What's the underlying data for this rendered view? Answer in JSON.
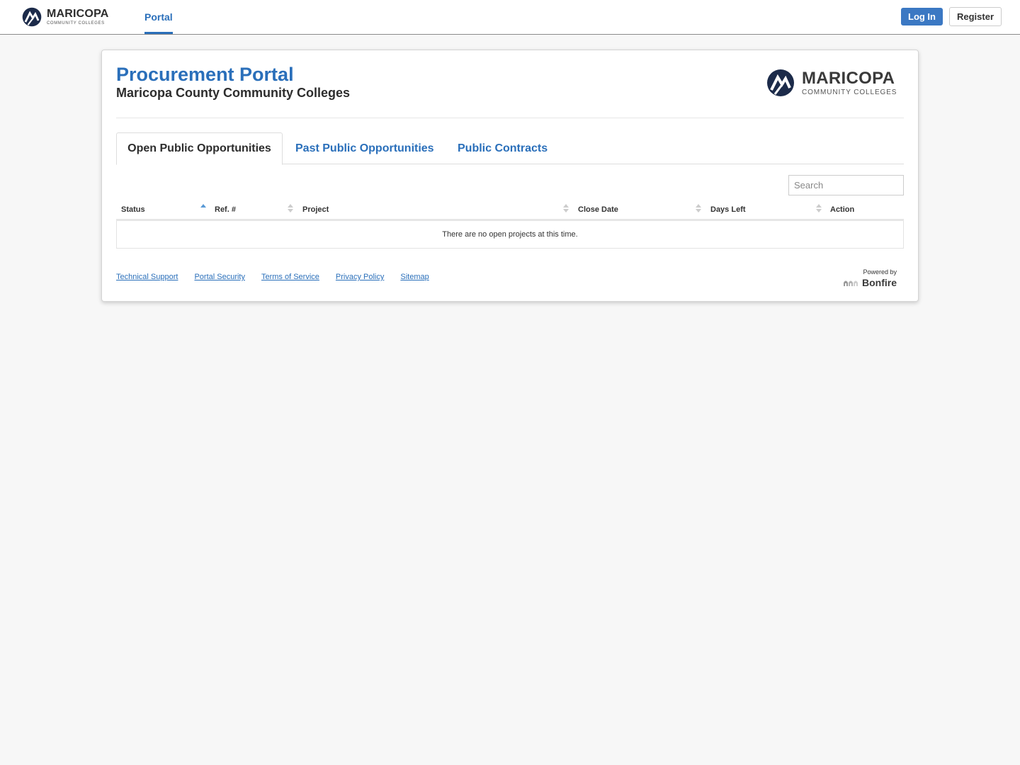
{
  "topnav": {
    "logo": {
      "name": "MARICOPA",
      "tagline": "COMMUNITY COLLEGES",
      "icon": "maricopa-logo-icon"
    },
    "active_link": "Portal",
    "login_label": "Log In",
    "register_label": "Register"
  },
  "header": {
    "title": "Procurement Portal",
    "subtitle": "Maricopa County Community Colleges",
    "logo": {
      "name": "MARICOPA",
      "tagline": "COMMUNITY COLLEGES"
    }
  },
  "tabs": [
    {
      "label": "Open Public Opportunities",
      "active": true
    },
    {
      "label": "Past Public Opportunities",
      "active": false
    },
    {
      "label": "Public Contracts",
      "active": false
    }
  ],
  "search": {
    "placeholder": "Search",
    "value": ""
  },
  "table": {
    "columns": [
      {
        "label": "Status",
        "sort": "asc"
      },
      {
        "label": "Ref. #",
        "sort": "none"
      },
      {
        "label": "Project",
        "sort": "none"
      },
      {
        "label": "Close Date",
        "sort": "none"
      },
      {
        "label": "Days Left",
        "sort": "none"
      },
      {
        "label": "Action",
        "sort": "none"
      }
    ],
    "empty_message": "There are no open projects at this time."
  },
  "footer": {
    "links": [
      "Technical Support",
      "Portal Security",
      "Terms of Service",
      "Privacy Policy",
      "Sitemap"
    ],
    "powered_by": "Powered by",
    "brand": "Bonfire"
  },
  "colors": {
    "accent": "#2a6fba",
    "login_button": "#3b78c3",
    "background": "#f7f7f7",
    "logo_navy": "#1c2b4a"
  }
}
